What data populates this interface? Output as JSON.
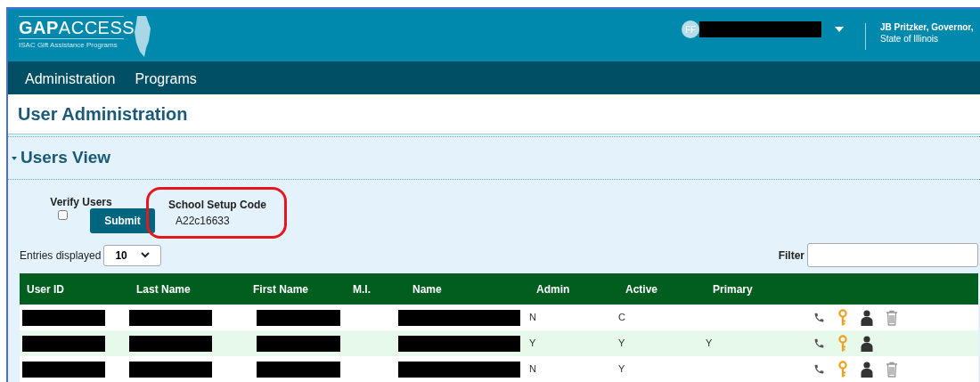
{
  "header": {
    "logo": "**GAP**ACCESS",
    "logo_subtitle": "ISAC Gift Assistance Programs",
    "avatar_initials": "FF",
    "governor_line_1": "JB Pritzker, Governor,",
    "governor_line_2": "State of Illinois"
  },
  "nav": [
    {
      "label": "Administration"
    },
    {
      "label": "Programs"
    }
  ],
  "page_title": "User Administration",
  "section": {
    "title": "Users View",
    "expanded": true
  },
  "verify": {
    "label": "Verify Users",
    "checked": false,
    "button": "Submit"
  },
  "setup_code": {
    "label": "School Setup Code",
    "value": "A22c16633",
    "highlighted": true
  },
  "entries": {
    "label": "Entries displayed",
    "value": "10"
  },
  "filter": {
    "label": "Filter"
  },
  "table": {
    "columns": [
      "User ID",
      "Last Name",
      "First Name",
      "M.I.",
      "Name",
      "Admin",
      "Active",
      "Primary"
    ],
    "rows": [
      {
        "admin": "N",
        "active": "C",
        "primary": "",
        "deletable": true
      },
      {
        "admin": "Y",
        "active": "Y",
        "primary": "Y",
        "deletable": false
      },
      {
        "admin": "N",
        "active": "Y",
        "primary": "",
        "deletable": true
      }
    ]
  }
}
